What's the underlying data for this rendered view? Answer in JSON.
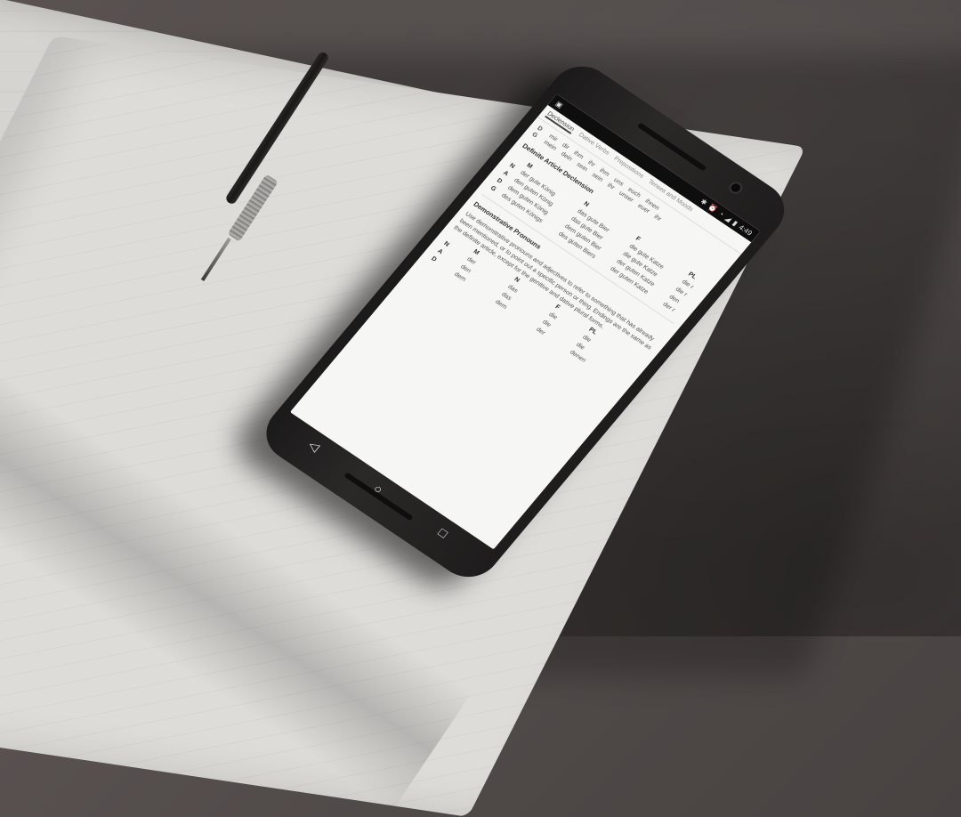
{
  "status_bar": {
    "time": "4:49"
  },
  "tabs": [
    {
      "label": "Declension",
      "active": true
    },
    {
      "label": "Dative Verbs",
      "active": false
    },
    {
      "label": "Prepositions",
      "active": false
    },
    {
      "label": "Tenses and Moods",
      "active": false
    }
  ],
  "pronoun_rows": [
    {
      "case": "D",
      "forms": [
        "mir",
        "dir",
        "ihm",
        "ihr",
        "ihm",
        "uns",
        "euch",
        "ihnen"
      ]
    },
    {
      "case": "G",
      "forms": [
        "mein",
        "dein",
        "sein",
        "sein",
        "ihr",
        "unser",
        "euer",
        "ihr"
      ]
    }
  ],
  "definite_article": {
    "heading": "Definite Article Declension",
    "columns": [
      "",
      "M",
      "N",
      "F",
      "PL"
    ],
    "rows": [
      {
        "case": "N",
        "cells": [
          "der gute König",
          "das gute Bier",
          "die gute Katze",
          "die r"
        ]
      },
      {
        "case": "A",
        "cells": [
          "den guten König",
          "das gute Bier",
          "die gute Katze",
          "die r"
        ]
      },
      {
        "case": "D",
        "cells": [
          "dem guten König",
          "dem guten Bier",
          "der guten Katze",
          "den"
        ]
      },
      {
        "case": "G",
        "cells": [
          "des guten Königs",
          "des guten Biers",
          "der guten Katze",
          "der r"
        ]
      }
    ]
  },
  "demonstrative": {
    "heading": "Demonstrative Pronouns",
    "paragraph": "Use demonstrative pronouns and adjectives to refer to something that has already been mentioned, or to point out a specific person or thing. Endings are the same as the definite article, except for the genitive and dative plural forms.",
    "columns": [
      "",
      "M",
      "N",
      "F",
      "PL"
    ],
    "rows": [
      {
        "case": "N",
        "cells": [
          "der",
          "das",
          "die",
          "die"
        ]
      },
      {
        "case": "A",
        "cells": [
          "den",
          "das",
          "die",
          "die"
        ]
      },
      {
        "case": "D",
        "cells": [
          "dem",
          "dem",
          "der",
          "denen"
        ]
      }
    ]
  },
  "nav": {
    "back": "◁",
    "home": "○",
    "recents": "□"
  }
}
